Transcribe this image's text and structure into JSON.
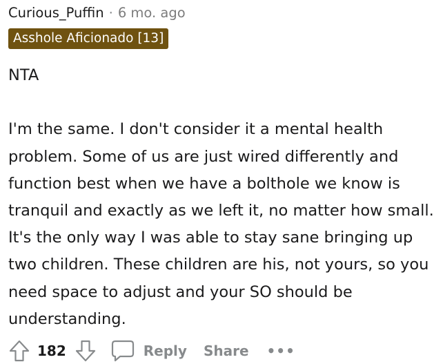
{
  "comment": {
    "username": "Curious_Puffin",
    "separator": "·",
    "timestamp": "6 mo. ago",
    "flair": "Asshole Aficionado [13]",
    "paragraphs": [
      "NTA",
      "I'm the same. I don't consider it a mental health problem. Some of us are just wired differently and function best when we have a bolthole we know is tranquil and exactly as we left it, no matter how small. It's the only way I was able to stay sane bringing up two children. These children are his, not yours, so you need space to adjust and your SO should be understanding."
    ],
    "actions": {
      "upvote_icon": "upvote-arrow-icon",
      "score": "182",
      "downvote_icon": "downvote-arrow-icon",
      "reply_icon": "speech-bubble-icon",
      "reply_label": "Reply",
      "share_label": "Share",
      "more_label": "•••"
    }
  },
  "colors": {
    "flair_background": "#6f5210",
    "muted_text": "#878a8c",
    "body_text": "#1a1a1b"
  }
}
